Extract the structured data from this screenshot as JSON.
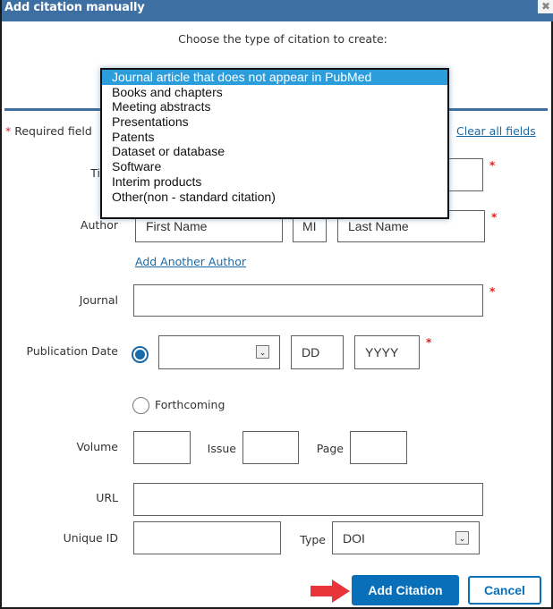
{
  "dialog": {
    "title": "Add citation manually",
    "close_icon": "close-icon",
    "close_glyph": "✖"
  },
  "chooser": {
    "label": "Choose the type of citation to create:",
    "options": [
      "Journal article that does not appear in PubMed",
      "Books and chapters",
      "Meeting abstracts",
      "Presentations",
      "Patents",
      "Dataset or database",
      "Software",
      "Interim products",
      "Other(non - standard citation)"
    ],
    "selected_index": 0
  },
  "form": {
    "required_star": "*",
    "required_note": " Required field",
    "clear_all": "Clear all fields",
    "title_label": "Title",
    "title_value": "",
    "author_label": "Author",
    "first_name_placeholder": "First Name",
    "mi_placeholder": "MI",
    "last_name_placeholder": "Last Name",
    "add_author": "Add Another Author",
    "journal_label": "Journal",
    "journal_value": "",
    "pub_date_label": "Publication Date",
    "month_value": "",
    "day_placeholder": "DD",
    "year_placeholder": "YYYY",
    "pub_date_selected": true,
    "forthcoming_label": "Forthcoming",
    "forthcoming_selected": false,
    "volume_label": "Volume",
    "issue_label": "Issue",
    "page_label": "Page",
    "url_label": "URL",
    "unique_id_label": "Unique ID",
    "type_label": "Type",
    "type_value": "DOI",
    "select_arrow_glyph": "⌄"
  },
  "buttons": {
    "add_citation": "Add Citation",
    "cancel": "Cancel"
  },
  "colors": {
    "header": "#3d6fa3",
    "primary": "#0a6fb9",
    "highlight": "#2b9ddb",
    "required": "#e01f1f",
    "annotation_arrow": "#e8343a"
  }
}
